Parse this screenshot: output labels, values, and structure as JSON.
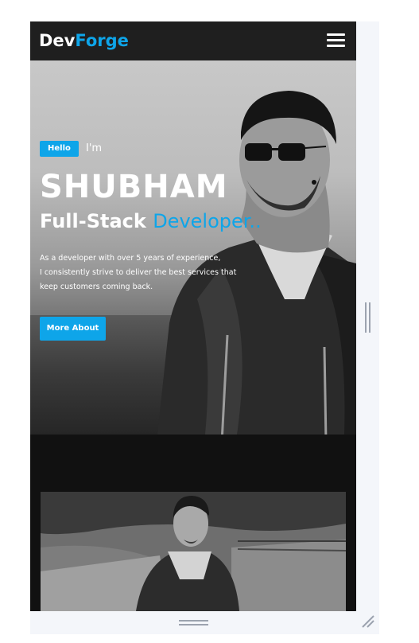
{
  "brand": {
    "prefix": "Dev",
    "suffix": "Forge"
  },
  "nav": {
    "menu_icon": "hamburger-menu-icon"
  },
  "hero": {
    "badge": "Hello",
    "intro": "I'm",
    "name": "SHUBHAM",
    "role_prefix": "Full-Stack",
    "role_highlight": "Developer..",
    "description_lines": [
      "As a developer with over 5 years of experience,",
      "I consistently strive to deliver the best services that",
      "keep customers coming back."
    ],
    "cta_label": "More About"
  },
  "colors": {
    "accent": "#0ea5e9",
    "nav_bg": "#1f1f1f",
    "page_bg": "#111111"
  },
  "frame_controls": {
    "side_grip": "vertical-resize-grip-icon",
    "bottom_grip": "horizontal-resize-grip-icon",
    "corner": "resize-corner-icon"
  }
}
